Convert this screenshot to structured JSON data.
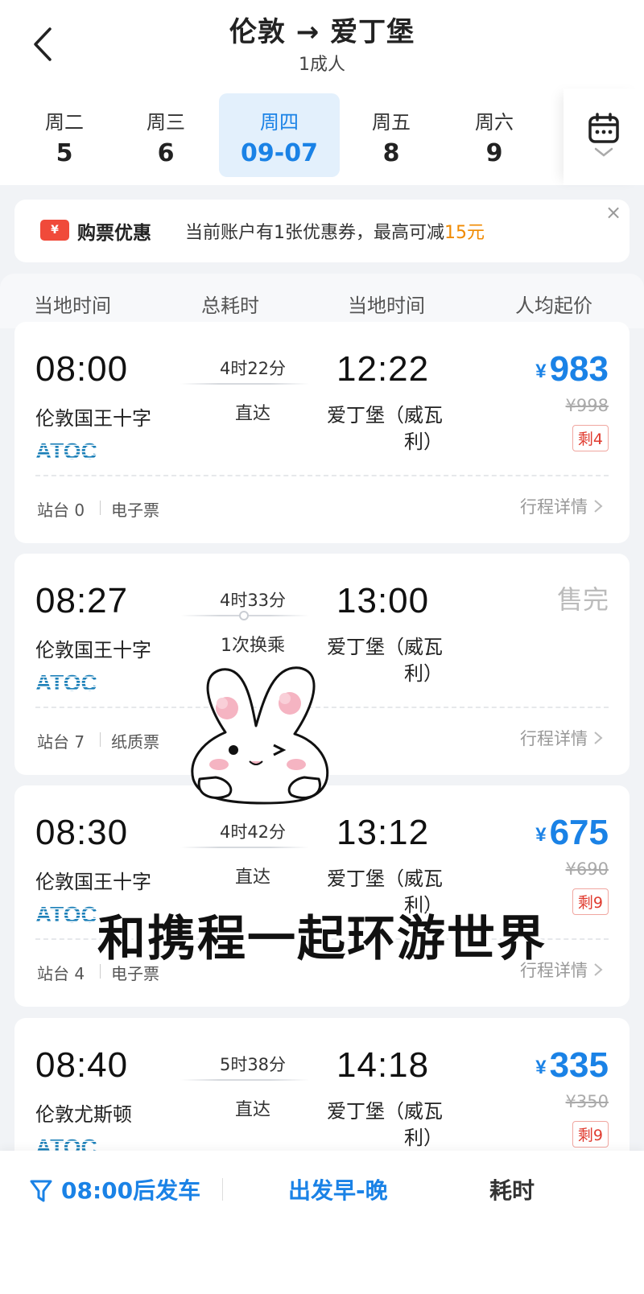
{
  "header": {
    "title": "伦敦 → 爱丁堡",
    "subtitle": "1成人",
    "back_icon": "chevron-left-icon"
  },
  "dates": [
    {
      "weekday": "周二",
      "date": "5",
      "selected": false
    },
    {
      "weekday": "周三",
      "date": "6",
      "selected": false
    },
    {
      "weekday": "周四",
      "date": "09-07",
      "selected": true
    },
    {
      "weekday": "周五",
      "date": "8",
      "selected": false
    },
    {
      "weekday": "周六",
      "date": "9",
      "selected": false
    }
  ],
  "calendar_icon": "calendar-icon",
  "promo": {
    "title": "购票优惠",
    "text": "当前账户有1张优惠券，最高可减",
    "amount": "15元",
    "close": "×"
  },
  "columns": {
    "dep": "当地时间",
    "duration": "总耗时",
    "arr": "当地时间",
    "price": "人均起价"
  },
  "trains": [
    {
      "dep_time": "08:00",
      "duration": "4时22分",
      "type": "直达",
      "arr_time": "12:22",
      "dep_station": "伦敦国王十字",
      "arr_station": "爱丁堡（威瓦利）",
      "operator": "ATOC",
      "yen": "¥",
      "price": "983",
      "orig_price": "¥998",
      "remain": "剩4",
      "soldout": "",
      "platform": "站台 0",
      "ticket": "电子票",
      "detail": "行程详情"
    },
    {
      "dep_time": "08:27",
      "duration": "4时33分",
      "type": "1次换乘",
      "arr_time": "13:00",
      "dep_station": "伦敦国王十字",
      "arr_station": "爱丁堡（威瓦利）",
      "operator": "ATOC",
      "yen": "",
      "price": "",
      "orig_price": "",
      "remain": "",
      "soldout": "售完",
      "platform": "站台 7",
      "ticket": "纸质票",
      "detail": "行程详情"
    },
    {
      "dep_time": "08:30",
      "duration": "4时42分",
      "type": "直达",
      "arr_time": "13:12",
      "dep_station": "伦敦国王十字",
      "arr_station": "爱丁堡（威瓦利）",
      "operator": "ATOC",
      "yen": "¥",
      "price": "675",
      "orig_price": "¥690",
      "remain": "剩9",
      "soldout": "",
      "platform": "站台 4",
      "ticket": "电子票",
      "detail": "行程详情"
    },
    {
      "dep_time": "08:40",
      "duration": "5时38分",
      "type": "直达",
      "arr_time": "14:18",
      "dep_station": "伦敦尤斯顿",
      "arr_station": "爱丁堡（威瓦利）",
      "operator": "ATOC",
      "yen": "¥",
      "price": "335",
      "orig_price": "¥350",
      "remain": "剩9",
      "soldout": "",
      "platform": "",
      "ticket": "",
      "detail": ""
    }
  ],
  "overlay": {
    "caption": "和携程一起环游世界",
    "sticker": "bunny-sticker"
  },
  "bottom": {
    "filter": "08:00后发车",
    "sort_time": "出发早-晚",
    "sort_duration": "耗时"
  },
  "colors": {
    "accent": "#1a82e6",
    "promo_amount": "#f08a00",
    "remain": "#e03a2e"
  }
}
